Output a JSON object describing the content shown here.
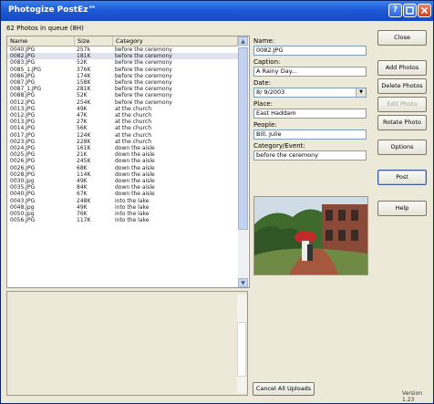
{
  "window": {
    "title": "Photogize PostEz™"
  },
  "queue_label": "62 Photos in queue (8H)",
  "table": {
    "columns": [
      "Name",
      "Size",
      "Category"
    ],
    "rows": [
      [
        "0040.JPG",
        "257k",
        "before the ceremony"
      ],
      [
        "0082.JPG",
        "181K",
        "before the ceremony"
      ],
      [
        "0083.JPG",
        "52K",
        "before the ceremony"
      ],
      [
        "0085_1.JPG",
        "376K",
        "before the ceremony"
      ],
      [
        "0086.JPG",
        "174K",
        "before the ceremony"
      ],
      [
        "0087.JPG",
        "158K",
        "before the ceremony"
      ],
      [
        "0087_1.JPG",
        "281K",
        "before the ceremony"
      ],
      [
        "0088.JPG",
        "52K",
        "before the ceremony"
      ],
      [
        "0012.JPG",
        "254K",
        "before the ceremony"
      ],
      [
        "0013.JPG",
        "49K",
        "at the church"
      ],
      [
        "0012.JPG",
        "47K",
        "at the church"
      ],
      [
        "0013.JPG",
        "27K",
        "at the church"
      ],
      [
        "0014.JPG",
        "56K",
        "at the church"
      ],
      [
        "0017.JPG",
        "124K",
        "at the church"
      ],
      [
        "0023.JPG",
        "228K",
        "at the church"
      ],
      [
        "0024.JPG",
        "161K",
        "down the aisle"
      ],
      [
        "0025.JPG",
        "21K",
        "down the aisle"
      ],
      [
        "0026.JPG",
        "245K",
        "down the aisle"
      ],
      [
        "0026.JPG",
        "68K",
        "down the aisle"
      ],
      [
        "0028.JPG",
        "114K",
        "down the aisle"
      ],
      [
        "0030.jpg",
        "49K",
        "down the aisle"
      ],
      [
        "0035.JPG",
        "84K",
        "down the aisle"
      ],
      [
        "0040.JPG",
        "67K",
        "down the aisle"
      ],
      [
        "0043.JPG",
        "248K",
        "into the lake"
      ],
      [
        "0048.jpg",
        "49K",
        "into the lake"
      ],
      [
        "0050.jpg",
        "76K",
        "into the lake"
      ],
      [
        "0056.JPG",
        "117K",
        "into the lake"
      ]
    ]
  },
  "fields": {
    "name_label": "Name:",
    "name_value": "0082.JPG",
    "caption_label": "Caption:",
    "caption_value": "A Rainy Day...",
    "date_label": "Date:",
    "date_value": "8/ 9/2003",
    "place_label": "Place:",
    "place_value": "East Haddam",
    "people_label": "People:",
    "people_value": "Bill, Julie",
    "category_label": "Category/Event:",
    "category_value": "before the ceremony"
  },
  "buttons": {
    "close": "Close",
    "add_photos": "Add Photos",
    "delete_photos": "Delete Photos",
    "edit_photo": "Edit Photo",
    "rotate_photo": "Rotate Photo",
    "options": "Options",
    "post": "Post",
    "help": "Help",
    "cancel_uploads": "Cancel All Uploads"
  },
  "version": "Version 1.23"
}
